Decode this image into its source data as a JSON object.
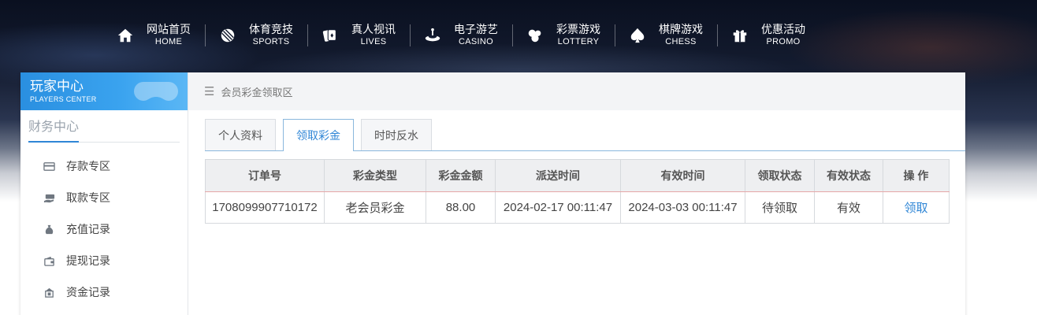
{
  "nav": [
    {
      "cn": "网站首页",
      "en": "HOME",
      "icon": "home-icon"
    },
    {
      "cn": "体育竞技",
      "en": "SPORTS",
      "icon": "ball-icon"
    },
    {
      "cn": "真人视讯",
      "en": "LIVES",
      "icon": "cards-icon"
    },
    {
      "cn": "电子游艺",
      "en": "CASINO",
      "icon": "slot-icon"
    },
    {
      "cn": "彩票游戏",
      "en": "LOTTERY",
      "icon": "lottery-balls-icon"
    },
    {
      "cn": "棋牌游戏",
      "en": "CHESS",
      "icon": "spade-icon"
    },
    {
      "cn": "优惠活动",
      "en": "PROMO",
      "icon": "gift-icon"
    }
  ],
  "sidebar": {
    "title": "玩家中心",
    "subtitle": "PLAYERS CENTER",
    "section": "财务中心",
    "items": [
      {
        "label": "存款专区",
        "icon": "deposit-card-icon"
      },
      {
        "label": "取款专区",
        "icon": "withdraw-cash-icon"
      },
      {
        "label": "充值记录",
        "icon": "money-bag-icon"
      },
      {
        "label": "提现记录",
        "icon": "wallet-icon"
      },
      {
        "label": "资金记录",
        "icon": "funds-record-icon"
      }
    ]
  },
  "breadcrumb": "会员彩金领取区",
  "tabs": [
    {
      "label": "个人资料",
      "active": false
    },
    {
      "label": "领取彩金",
      "active": true
    },
    {
      "label": "时时反水",
      "active": false
    }
  ],
  "table": {
    "headers": [
      "订单号",
      "彩金类型",
      "彩金金额",
      "派送时间",
      "有效时间",
      "领取状态",
      "有效状态",
      "操 作"
    ],
    "rows": [
      [
        "1708099907710172",
        "老会员彩金",
        "88.00",
        "2024-02-17 00:11:47",
        "2024-03-03 00:11:47",
        "待领取",
        "有效",
        "领取"
      ]
    ]
  },
  "colors": {
    "accent": "#2f86d6",
    "header_blue": "#3aa3ef"
  }
}
